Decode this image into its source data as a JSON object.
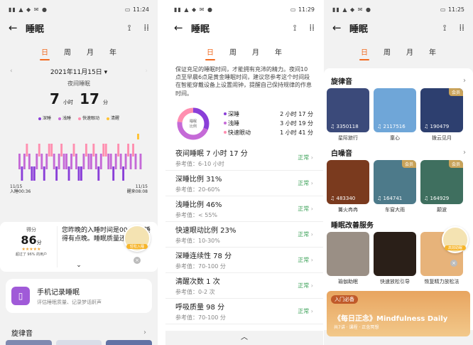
{
  "p1": {
    "time": "11:24",
    "title": "睡眠",
    "tabs": [
      "日",
      "周",
      "月",
      "年"
    ],
    "date": "2021年11月15日",
    "section": "夜间睡眠",
    "hours": "7",
    "hours_unit": "小时",
    "minutes": "17",
    "minutes_unit": "分",
    "legend": [
      {
        "label": "深睡",
        "color": "#8a3fd8"
      },
      {
        "label": "浅睡",
        "color": "#c56ad7"
      },
      {
        "label": "快速眼动",
        "color": "#ff8fb0"
      },
      {
        "label": "清醒",
        "color": "#ffc233"
      }
    ],
    "start_label": "11/15\n入睡00:36",
    "end_label": "11/15\n醒来08:08",
    "score_label": "得分",
    "score": "86",
    "score_unit": "分",
    "score_sub": "超过了 96% 的用户",
    "comment": "您昨晚的入睡时间是00:36，睡得有点晚。睡眠质量还不错。",
    "float_label": "轻松入睡",
    "record_title": "手机记录睡眠",
    "record_sub": "评估睡眠质量、记录梦话鼾声",
    "next_section": "旋律音"
  },
  "p2": {
    "time": "11:29",
    "title": "睡眠",
    "tabs": [
      "日",
      "周",
      "月",
      "年"
    ],
    "intro": "保证充足的睡眠时间，才能拥有充沛的精力。夜间10点至早晨6点是黄金睡眠时间，建议您参考这个时间段在智能穿戴设备上设置闹钟，提醒自己保持规律的作息时间。",
    "ring_label": "睡眠比例",
    "ring": [
      {
        "label": "深睡",
        "value": "2 小时 17 分",
        "color": "#8a3fd8",
        "fraction": 0.31
      },
      {
        "label": "浅睡",
        "value": "3 小时 19 分",
        "color": "#c56ad7",
        "fraction": 0.46
      },
      {
        "label": "快速眼动",
        "value": "1 小时 41 分",
        "color": "#ff8fb0",
        "fraction": 0.23
      }
    ],
    "rows": [
      {
        "title": "夜间睡眠  7 小时 17 分",
        "ref": "参考值：6-10 小时",
        "status": "正常"
      },
      {
        "title": "深睡比例  31%",
        "ref": "参考值：20-60%",
        "status": "正常"
      },
      {
        "title": "浅睡比例  46%",
        "ref": "参考值：< 55%",
        "status": "正常"
      },
      {
        "title": "快速眼动比例  23%",
        "ref": "参考值：10-30%",
        "status": "正常"
      },
      {
        "title": "深睡连续性  78 分",
        "ref": "参考值：70-100 分",
        "status": "正常"
      },
      {
        "title": "清醒次数  1 次",
        "ref": "参考值：0-2 次",
        "status": "正常"
      },
      {
        "title": "呼吸质量  98 分",
        "ref": "参考值：70-100 分",
        "status": "正常"
      }
    ]
  },
  "p3": {
    "time": "11:25",
    "title": "睡眠",
    "tabs": [
      "日",
      "周",
      "月",
      "年"
    ],
    "sec1": "旋律音",
    "melody": [
      {
        "count": "3350118",
        "name": "星际旅行",
        "color": "#3b4a7a",
        "badge": ""
      },
      {
        "count": "2117516",
        "name": "童心",
        "color": "#6fa6d8",
        "badge": ""
      },
      {
        "count": "190479",
        "name": "拨云见月",
        "color": "#2d3f6f",
        "badge": "会员"
      }
    ],
    "sec2": "白噪音",
    "noise": [
      {
        "count": "483340",
        "name": "篝火冉冉",
        "color": "#7a3a1e",
        "badge": ""
      },
      {
        "count": "164741",
        "name": "车窗大雨",
        "color": "#4d7a8a",
        "badge": "会员"
      },
      {
        "count": "164929",
        "name": "颠波",
        "color": "#3f6f5f",
        "badge": "会员"
      }
    ],
    "sec3": "睡眠改善服务",
    "services": [
      {
        "name": "瑜伽助眠",
        "color": "#9a8f85"
      },
      {
        "name": "快速放松引导",
        "color": "#2a1f18"
      },
      {
        "name": "恢复精力放松法",
        "color": "#e7b37a"
      }
    ],
    "float_label": "高效助眠",
    "banner_tag": "入门必备",
    "banner_title": "《每日正念》Mindfulness Daily",
    "banner_sub": "共7讲 · 课程 · 正念冥想"
  }
}
